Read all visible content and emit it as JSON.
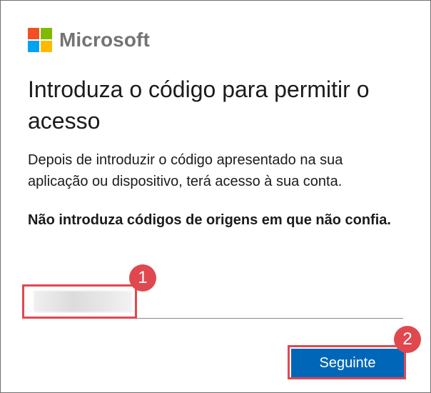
{
  "brand": {
    "name": "Microsoft",
    "logo_colors": [
      "#f25022",
      "#7fba00",
      "#00a4ef",
      "#ffb900"
    ]
  },
  "title": "Introduza o código para permitir o acesso",
  "description": "Depois de introduzir o código apresentado na sua aplicação ou dispositivo, terá acesso à sua conta.",
  "warning": "Não introduza códigos de origens em que não confia.",
  "code_input": {
    "value": "",
    "placeholder": ""
  },
  "next_button": {
    "label": "Seguinte"
  },
  "annotations": {
    "badge_1": "1",
    "badge_2": "2",
    "highlight_color": "#e0484f"
  },
  "colors": {
    "primary_button": "#0067b8",
    "text": "#1b1b1b"
  }
}
